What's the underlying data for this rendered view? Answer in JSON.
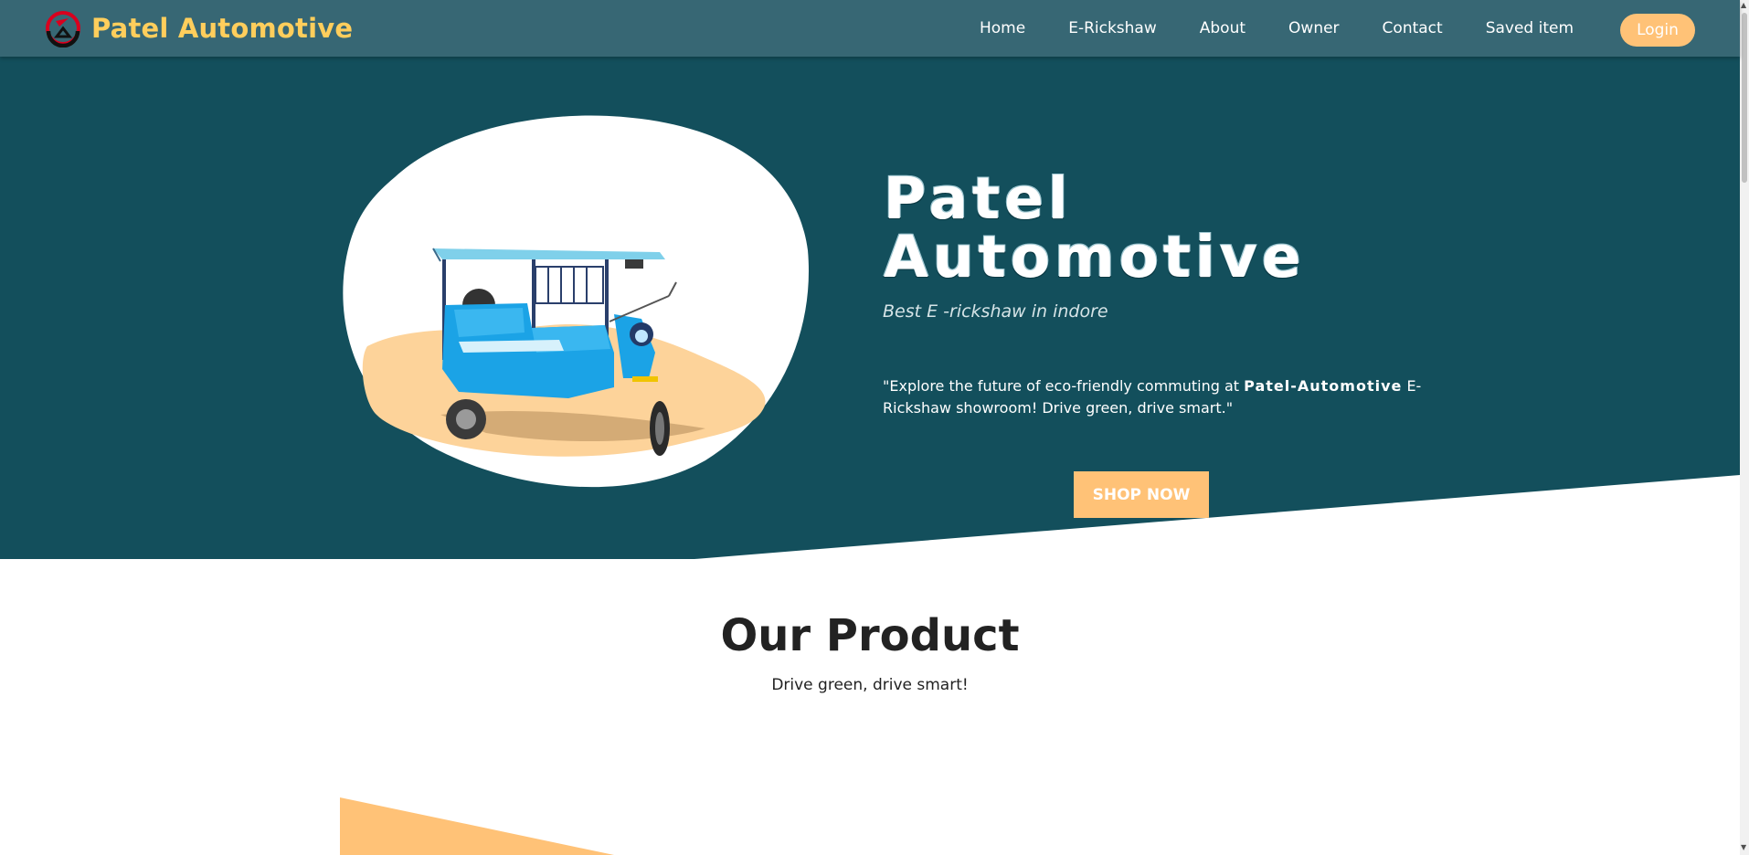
{
  "navbar": {
    "brand": "Patel Automotive",
    "logo_icon": "brand-logo-icon",
    "links": [
      "Home",
      "E-Rickshaw",
      "About",
      "Owner",
      "Contact",
      "Saved item"
    ],
    "login": "Login"
  },
  "hero": {
    "title_line1": "Patel",
    "title_line2": "Automotive",
    "subtitle": "Best E -rickshaw in indore",
    "desc_before": "\"Explore the future of eco-friendly commuting at ",
    "desc_brand": "Patel-Automotive",
    "desc_after": " E-Rickshaw showroom! Drive green, drive smart.\"",
    "cta": "SHOP NOW",
    "image": "e-rickshaw-illustration"
  },
  "products": {
    "title": "Our Product",
    "subtitle": "Drive green, drive smart!"
  },
  "colors": {
    "navbar_bg": "#376774",
    "hero_bg": "#134f5c",
    "brand_text": "#ffce5c",
    "accent": "#ffc277",
    "heading_text": "#222222"
  }
}
